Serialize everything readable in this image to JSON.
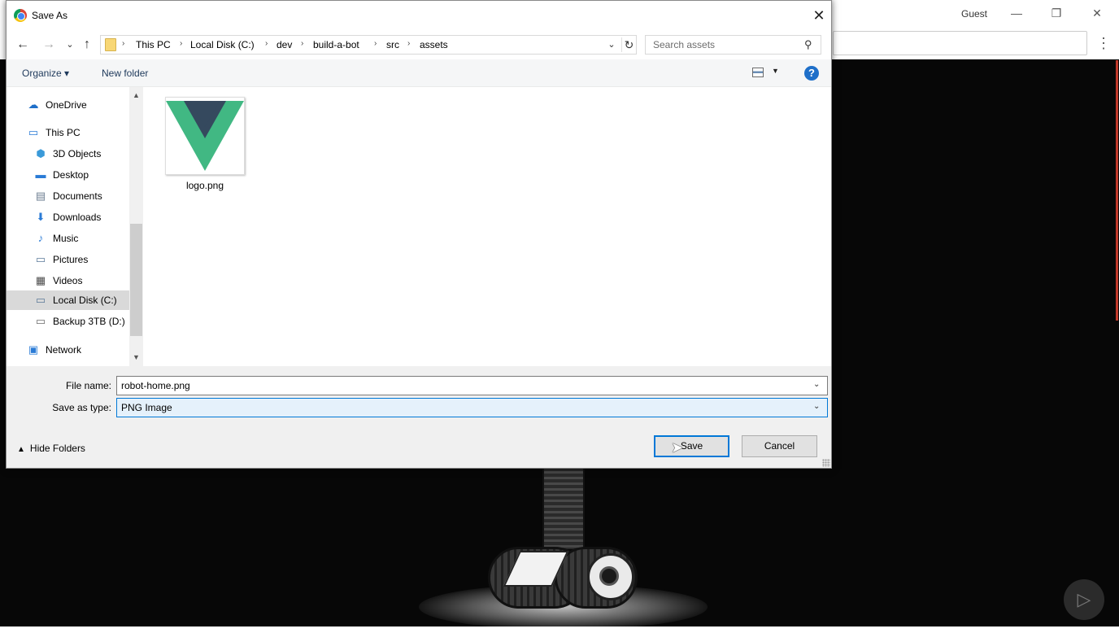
{
  "browser": {
    "profile_label": "Guest",
    "window_controls": {
      "minimize": "—",
      "restore": "❐",
      "close": "✕"
    },
    "menu": "⋮"
  },
  "dialog": {
    "title": "Save As",
    "close": "✕",
    "nav": {
      "back": "←",
      "forward": "→",
      "recent": "⌄",
      "up": "↑"
    },
    "breadcrumb": [
      "This PC",
      "Local Disk (C:)",
      "dev",
      "build-a-bot",
      "src",
      "assets"
    ],
    "breadcrumb_separator": "›",
    "breadcrumb_dropdown": "⌄",
    "refresh": "↻",
    "search": {
      "placeholder": "Search assets",
      "icon": "⚲"
    },
    "toolbar": {
      "organize": "Organize ▾",
      "new_folder": "New folder",
      "view_drop": "▼",
      "help": "?"
    },
    "sidebar": {
      "items": [
        {
          "label": "OneDrive",
          "icon": "cloud-icon",
          "glyph": "☁",
          "color": "#1e6fc9"
        },
        {
          "label": "This PC",
          "icon": "computer-icon",
          "glyph": "🖥",
          "color": "#2a7bd6"
        },
        {
          "label": "3D Objects",
          "icon": "cube-icon",
          "glyph": "⬢",
          "color": "#3a9ad9"
        },
        {
          "label": "Desktop",
          "icon": "desktop-icon",
          "glyph": "▬",
          "color": "#2a7bd6"
        },
        {
          "label": "Documents",
          "icon": "document-icon",
          "glyph": "▤",
          "color": "#6d7e91"
        },
        {
          "label": "Downloads",
          "icon": "download-icon",
          "glyph": "⬇",
          "color": "#2a7bd6"
        },
        {
          "label": "Music",
          "icon": "music-icon",
          "glyph": "♪",
          "color": "#2a7bd6"
        },
        {
          "label": "Pictures",
          "icon": "picture-icon",
          "glyph": "▭",
          "color": "#5b7a99"
        },
        {
          "label": "Videos",
          "icon": "video-icon",
          "glyph": "▦",
          "color": "#4a4a4a"
        },
        {
          "label": "Local Disk (C:)",
          "icon": "drive-icon",
          "glyph": "▭",
          "color": "#5b7a99"
        },
        {
          "label": "Backup 3TB (D:)",
          "icon": "drive-icon",
          "glyph": "▭",
          "color": "#6b6b6b"
        },
        {
          "label": "Network",
          "icon": "network-icon",
          "glyph": "🖧",
          "color": "#2a7bd6"
        }
      ],
      "selected": "Local Disk (C:)",
      "scroll_up": "▲",
      "scroll_down": "▼"
    },
    "files": [
      {
        "name": "logo.png",
        "icon": "vue-logo-icon"
      }
    ],
    "file_name": {
      "label": "File name:",
      "value": "robot-home.png",
      "drop": "⌄"
    },
    "save_as_type": {
      "label": "Save as type:",
      "value": "PNG Image",
      "drop": "⌄"
    },
    "hide_folders": {
      "caret": "▲",
      "label": "Hide Folders"
    },
    "buttons": {
      "save": "Save",
      "cancel": "Cancel"
    }
  },
  "colors": {
    "accent": "#0078d7",
    "vue_green": "#41b883",
    "vue_dark": "#35495e"
  }
}
